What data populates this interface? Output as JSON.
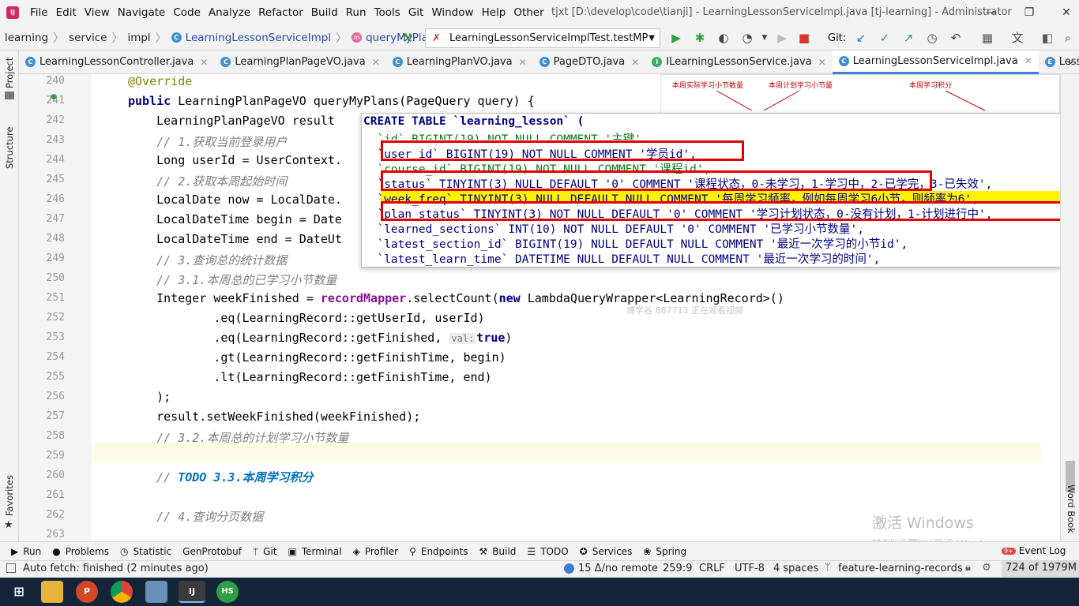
{
  "menubar": {
    "items": [
      "File",
      "Edit",
      "View",
      "Navigate",
      "Code",
      "Analyze",
      "Refactor",
      "Build",
      "Run",
      "Tools",
      "Git",
      "Window",
      "Help",
      "Other"
    ],
    "window_title": "tjxt [D:\\develop\\code\\tianji] - LearningLessonServiceImpl.java [tj-learning] - Administrator"
  },
  "navbar": {
    "breadcrumbs": [
      "learning",
      "service",
      "impl",
      "LearningLessonServiceImpl",
      "queryMyPlans"
    ],
    "run_config": "LearningLessonServiceImplTest.testMP",
    "git_label": "Git:"
  },
  "tabs": [
    {
      "label": "LearningLessonController.java",
      "icon": "class-icon"
    },
    {
      "label": "LearningPlanPageVO.java",
      "icon": "class-icon"
    },
    {
      "label": "LearningPlanVO.java",
      "icon": "class-icon"
    },
    {
      "label": "PageDTO.java",
      "icon": "class-icon"
    },
    {
      "label": "ILearningLessonService.java",
      "icon": "interface-icon"
    },
    {
      "label": "LearningLessonServiceImpl.java",
      "icon": "class-icon",
      "active": true
    },
    {
      "label": "LessonSt",
      "icon": "enum-icon"
    }
  ],
  "left_tools": [
    "Project",
    "Structure",
    "Favorites"
  ],
  "right_tools": [
    "Word Book"
  ],
  "editor": {
    "line_numbers": [
      "240",
      "241",
      "242",
      "243",
      "244",
      "245",
      "246",
      "247",
      "248",
      "249",
      "250",
      "251",
      "252",
      "253",
      "254",
      "255",
      "256",
      "257",
      "258",
      "259",
      "260",
      "261",
      "262",
      "263"
    ],
    "lines": {
      "l240": "@Override",
      "l241a": "public",
      "l241b": " LearningPlanPageVO queryMyPlans(PageQuery query) {",
      "l242": "    LearningPlanPageVO result",
      "l243": "    // 1.获取当前登录用户",
      "l244": "    Long userId = UserContext.",
      "l245": "    // 2.获取本周起始时间",
      "l246": "    LocalDate now = LocalDate.",
      "l247": "    LocalDateTime begin = Date",
      "l248": "    LocalDateTime end = DateUt",
      "l249": "    // 3.查询总的统计数据",
      "l250": "    // 3.1.本周总的已学习小节数量",
      "l251a": "    Integer weekFinished = ",
      "l251b": "recordMapper",
      "l251c": ".selectCount(",
      "l251d": "new",
      "l251e": " LambdaQueryWrapper<LearningRecord>()",
      "l252": "            .eq(LearningRecord::getUserId, userId)",
      "l253a": "            .eq(LearningRecord::getFinished, ",
      "l253hint": "val:",
      "l253b": "true",
      "l253c": ")",
      "l254": "            .gt(LearningRecord::getFinishTime, begin)",
      "l255": "            .lt(LearningRecord::getFinishTime, end)",
      "l256": "    );",
      "l257": "    result.setWeekFinished(weekFinished);",
      "l258": "    // 3.2.本周总的计划学习小节数量",
      "l260a": "    // ",
      "l260b": "TODO 3.3.本周学习积分",
      "l262": "    // 4.查询分页数据"
    }
  },
  "sql_popup": {
    "line1": "CREATE TABLE `learning_lesson` (",
    "line2": "  `id` BIGINT(19) NOT NULL COMMENT '主键',",
    "line3": "  `user_id` BIGINT(19) NOT NULL COMMENT '学员id',",
    "line4": "  `course_id` BIGINT(19) NOT NULL COMMENT '课程id',",
    "line5": "  `status` TINYINT(3) NULL DEFAULT '0' COMMENT '课程状态，0-未学习，1-学习中，2-已学完，3-已失效',",
    "line6": "  `week_freq` TINYINT(3) NULL DEFAULT NULL COMMENT '每周学习频率，例如每周学习6小节，则频率为6',",
    "line7": "  `plan_status` TINYINT(3) NOT NULL DEFAULT '0' COMMENT '学习计划状态，0-没有计划，1-计划进行中',",
    "line8": "  `learned_sections` INT(10) NOT NULL DEFAULT '0' COMMENT '已学习小节数量',",
    "line9": "  `latest_section_id` BIGINT(19) NULL DEFAULT NULL COMMENT '最近一次学习的小节id',",
    "line10": "  `latest_learn_time` DATETIME NULL DEFAULT NULL COMMENT '最近一次学习的时间',"
  },
  "image_panel": {
    "label1": "本周实际学习小节数量",
    "label2": "本周计划学习小节量",
    "label3": "本周学习积分"
  },
  "overlay": {
    "watermark": "博学谷 887713 正在观看视频",
    "activate_title": "激活 Windows",
    "activate_sub": "转到\"设置\"以激活 Windows。"
  },
  "bottom_tools": [
    "Run",
    "Problems",
    "Statistic",
    "GenProtobuf",
    "Git",
    "Terminal",
    "Profiler",
    "Endpoints",
    "Build",
    "TODO",
    "Services",
    "Spring"
  ],
  "event_log": {
    "label": "Event Log",
    "badge": "9+"
  },
  "statusbar": {
    "left": "Auto fetch: finished (2 minutes ago)",
    "git_changes": "15 Δ/no remote",
    "position": "259:9",
    "line_sep": "CRLF",
    "encoding": "UTF-8",
    "indent": "4 spaces",
    "branch": "feature-learning-records",
    "memory": "724 of 1979M"
  },
  "taskbar": {
    "apps": [
      "start",
      "explorer",
      "powerpoint",
      "chrome",
      "snipping",
      "intellij",
      "hs"
    ],
    "hs_label": "HS",
    "ppt_label": "P"
  },
  "colors": {
    "accent": "#3e7ed6",
    "red_box": "#e00000",
    "keyword": "#000080",
    "comment": "#808080",
    "string": "#067d17"
  }
}
